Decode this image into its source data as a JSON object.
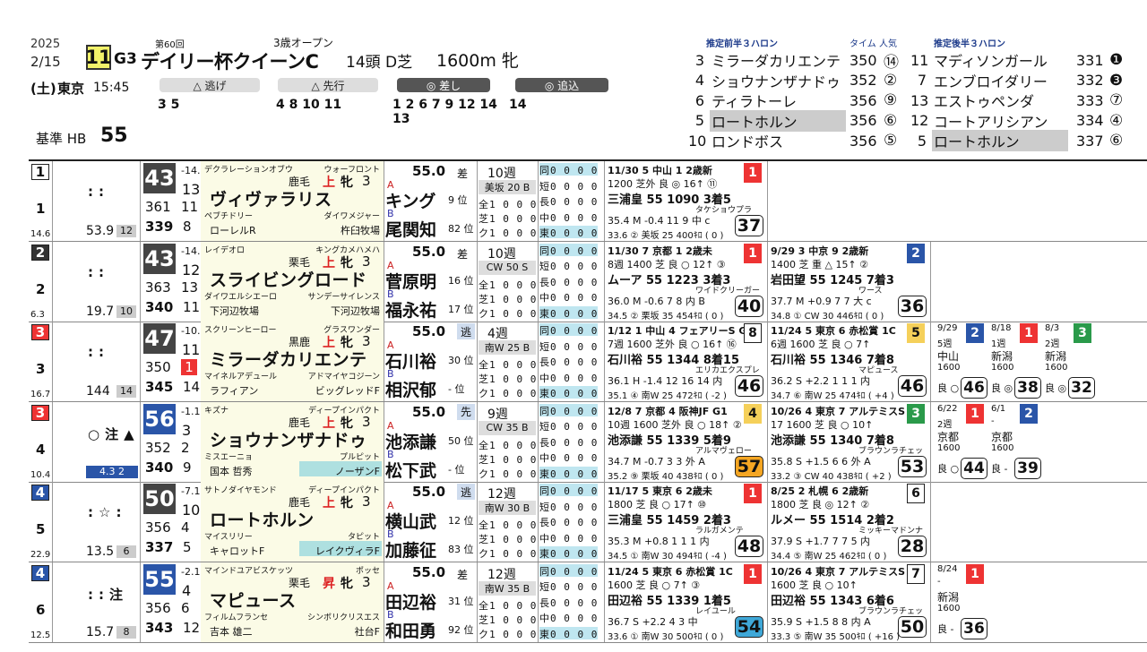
{
  "header": {
    "year": "2025",
    "date": "2/15",
    "race_no": "11",
    "grade": "G3",
    "nth": "第60回",
    "class": "3歳オープン",
    "title": "デイリー杯クイーンC",
    "heads": "14頭",
    "course": "D芝",
    "distance": "1600m 牝",
    "dow": "(土)",
    "venue": "東京",
    "post_time": "15:45",
    "hb_label": "基準 HB",
    "hb_value": "55"
  },
  "styles": [
    {
      "label": "△ 逃げ",
      "horses": "3 5"
    },
    {
      "label": "△ 先行",
      "horses": "4 8 10 11"
    },
    {
      "label": "◎ 差し",
      "horses": "1 2 6 7 9 12 14",
      "horses2": "13"
    },
    {
      "label": "◎ 追込",
      "horses": "14"
    }
  ],
  "pace": {
    "front_title": "推定前半３ハロン",
    "front_sub": "タイム 人気",
    "back_title": "推定後半３ハロン",
    "front": [
      {
        "no": "3",
        "name": "ミラーダカリエンテ",
        "time": "350",
        "rank": "⑭"
      },
      {
        "no": "4",
        "name": "ショウナンザナドゥ",
        "time": "352",
        "rank": "②"
      },
      {
        "no": "6",
        "name": "ティラトーレ",
        "time": "356",
        "rank": "⑨"
      },
      {
        "no": "5",
        "name": "ロートホルン",
        "time": "356",
        "rank": "⑥"
      },
      {
        "no": "10",
        "name": "ロンドボス",
        "time": "356",
        "rank": "⑤"
      }
    ],
    "back": [
      {
        "no": "11",
        "name": "マディソンガール",
        "time": "331",
        "rank": "❶"
      },
      {
        "no": "7",
        "name": "エンブロイダリー",
        "time": "332",
        "rank": "❸"
      },
      {
        "no": "13",
        "name": "エストゥペンダ",
        "time": "333",
        "rank": "⑦"
      },
      {
        "no": "12",
        "name": "コートアリシアン",
        "time": "334",
        "rank": "④"
      },
      {
        "no": "5",
        "name": "ロートホルン",
        "time": "337",
        "rank": "⑥"
      }
    ]
  },
  "rows": [
    {
      "frame": "1",
      "no": "1",
      "foot": "14.6",
      "mark": "::",
      "odds": "53.9",
      "odds_rank": "12",
      "idx": "43",
      "idx_d": "-14.1",
      "idx_r": "13",
      "s1": "361",
      "r1": "11",
      "s2": "339",
      "r2": "8",
      "sire": "デクラレーションオブウ",
      "sire2": "ウォーフロント",
      "coat": "鹿毛",
      "sex": "上",
      "sexj": "牝",
      "age": "3",
      "name": "ヴィヴァラリス",
      "dam": "ペブチドリー",
      "dam2": "ダイワメジャー",
      "breeder": "ローレルR",
      "breeder2": "杵臼牧場",
      "weight": "55.0",
      "style": "差",
      "j1": "キング",
      "j1r": "9 位",
      "j2": "尾関知",
      "j2r": "82 位",
      "tr1": "10週",
      "trbox": "美坂 20 B",
      "past1": {
        "date": "11/30",
        "venue": "5 中山 1 2歳新",
        "line2": "1200 芝外 良 ◎ 16↑ ⑪",
        "line3": "三浦皇 55 1090 3着5",
        "line4": "タケショウプラ",
        "line5": "35.4 M -0.4 11 9 中 c",
        "line6": "33.6 ② 美坂 25 400ｷﾛ ( 0 )",
        "res": "1",
        "score": "37"
      }
    },
    {
      "frame": "2",
      "no": "2",
      "foot": "6.3",
      "mark": "::",
      "odds": "19.7",
      "odds_rank": "10",
      "idx": "43",
      "idx_d": "-14.0",
      "idx_r": "12",
      "s1": "363",
      "r1": "13",
      "s2": "340",
      "r2": "11",
      "sire": "レイデオロ",
      "sire2": "キングカメハメハ",
      "coat": "栗毛",
      "sex": "上",
      "sexj": "牝",
      "age": "3",
      "name": "スライビングロード",
      "dam": "ダイワエルシエーロ",
      "dam2": "サンデーサイレンス",
      "breeder": "下河辺牧場",
      "breeder2": "下河辺牧場",
      "weight": "55.0",
      "style": "差",
      "j1": "菅原明",
      "j1r": "16 位",
      "j2": "福永祐",
      "j2r": "17 位",
      "tr1": "10週",
      "trbox": "CW 50 S",
      "past1": {
        "date": "11/30",
        "venue": "7 京都 1 2歳未",
        "line2": "8週 1400 芝 良 ○ 12↑ ③",
        "line3": "ムーア 55 1223 3着3",
        "line4": "ワイドクリーガー",
        "line5": "36.0 M -0.6 7 8 内 B",
        "line6": "34.5 ② 栗坂 35 454ｷﾛ ( 0 )",
        "res": "1",
        "score": "40"
      },
      "past2": {
        "date": "9/29",
        "venue": "3 中京 9 2歳新",
        "line2": "1400 芝 重 △ 15↑ ②",
        "line3": "岩田望 55 1245 7着3",
        "line4": "ワース",
        "line5": "37.7 M +0.9 7 7 大 c",
        "line6": "34.8 ① CW 30 446ｷﾛ ( 0 )",
        "res": "2",
        "score": "36"
      }
    },
    {
      "frame": "3",
      "no": "3",
      "foot": "16.7",
      "mark": "::",
      "odds": "144",
      "odds_rank": "14",
      "idx": "47",
      "idx_d": "-10.1",
      "idx_r": "11",
      "s1": "350",
      "r1": "1",
      "s2": "345",
      "r2": "14",
      "sire": "スクリーンヒーロー",
      "sire2": "グラスワンダー",
      "coat": "黒鹿",
      "sex": "上",
      "sexj": "牝",
      "age": "3",
      "name": "ミラーダカリエンテ",
      "dam": "マイネルアデュール",
      "dam2": "アドマイヤコジーン",
      "breeder": "ラフィアン",
      "breeder2": "ビッグレッドF",
      "weight": "55.0",
      "style": "逃",
      "j1": "石川裕",
      "j1r": "30 位",
      "j2": "相沢郁",
      "j2r": "- 位",
      "tr1": "4週",
      "trbox": "南W 25 B",
      "past1": {
        "date": "1/12",
        "venue": "1 中山 4 フェアリーS G3",
        "line2": "7週 1600 芝外 良 ○ 16↑ ⑯",
        "line3": "石川裕 55 1344 8着15",
        "line4": "エリカエクスプレ",
        "line5": "36.1 H -1.4 12 16 14 内",
        "line6": "35.1 ④ 南W 25 472ｷﾛ ( -2 )",
        "res": "8",
        "score": "46"
      },
      "past2": {
        "date": "11/24",
        "venue": "5 東京 6 赤松賞 1C",
        "line2": "6週 1600 芝 良 ○ 7↑",
        "line3": "石川裕 55 1346 7着8",
        "line4": "マピュース",
        "line5": "36.2 S +2.2 1 1 1 内",
        "line6": "34.7 ⑥ 南W 25 474ｷﾛ ( +4 )",
        "res": "5",
        "score": "46"
      },
      "mini": [
        {
          "date": "9/29",
          "w": "5週",
          "v": "中山",
          "d": "1600",
          "g": "良 ○",
          "res": "2",
          "score": "46"
        },
        {
          "date": "8/18",
          "w": "1週",
          "v": "新潟",
          "d": "1600",
          "g": "良 ◎",
          "res": "1",
          "score": "38"
        },
        {
          "date": "8/3",
          "w": "2週",
          "v": "新潟",
          "d": "1600",
          "g": "良 ◎",
          "res": "3",
          "score": "32"
        }
      ]
    },
    {
      "frame": "3",
      "no": "4",
      "foot": "10.4",
      "mark": "○注▲",
      "odds": "4.3",
      "odds_rank": "2",
      "idx": "56",
      "idx_d": "-1.1",
      "idx_r": "3",
      "s1": "352",
      "r1": "2",
      "s2": "340",
      "r2": "9",
      "sire": "キズナ",
      "sire2": "ディープインパクト",
      "coat": "鹿毛",
      "sex": "上",
      "sexj": "牝",
      "age": "3",
      "name": "ショウナンザナドゥ",
      "dam": "ミスエーニョ",
      "dam2": "プルピット",
      "breeder": "国本 哲秀",
      "breeder2": "ノーザンF",
      "weight": "55.0",
      "style": "先",
      "j1": "池添謙",
      "j1r": "50 位",
      "j2": "松下武",
      "j2r": "- 位",
      "tr1": "9週",
      "trbox": "CW 35 B",
      "past1": {
        "date": "12/8",
        "venue": "7 京都 4 阪神JF G1",
        "line2": "10週 1600 芝外 良 ○ 18↑ ②",
        "line3": "池添謙 55 1339 5着9",
        "line4": "アルマヴェロー",
        "line5": "34.7 M -0.7 3 3 外 A",
        "line6": "35.2 ⑨ 栗坂 40 438ｷﾛ ( 0 )",
        "res": "4",
        "score": "57"
      },
      "past2": {
        "date": "10/26",
        "venue": "4 東京 7 アルテミスS G3",
        "line2": "17 1600 芝 良 ○ 10↑",
        "line3": "池添謙 55 1340 7着8",
        "line4": "ブラウンラチェッ",
        "line5": "35.8 S +1.5 6 6 外 A",
        "line6": "33.2 ③ CW 40 438ｷﾛ ( +2 )",
        "res": "3",
        "score": "53"
      },
      "mini": [
        {
          "date": "6/22",
          "w": "2週",
          "v": "京都",
          "d": "1600",
          "g": "良 ○",
          "res": "1",
          "score": "44"
        },
        {
          "date": "6/1",
          "w": "-",
          "v": "京都",
          "d": "1600",
          "g": "良 -",
          "res": "2",
          "score": "39"
        }
      ]
    },
    {
      "frame": "4",
      "no": "5",
      "foot": "22.9",
      "mark": ":☆:",
      "odds": "13.5",
      "odds_rank": "6",
      "idx": "50",
      "idx_d": "-7.1",
      "idx_r": "10",
      "s1": "356",
      "r1": "4",
      "s2": "337",
      "r2": "5",
      "sire": "サトノダイヤモンド",
      "sire2": "ディープインパクト",
      "coat": "鹿毛",
      "sex": "上",
      "sexj": "牝",
      "age": "3",
      "name": "ロートホルン",
      "dam": "マイスリリー",
      "dam2": "タピット",
      "breeder": "キャロットF",
      "breeder2": "レイクヴィラF",
      "weight": "55.0",
      "style": "逃",
      "j1": "横山武",
      "j1r": "12 位",
      "j2": "加藤征",
      "j2r": "83 位",
      "tr1": "12週",
      "trbox": "南W 30 B",
      "past1": {
        "date": "11/17",
        "venue": "5 東京 6 2歳未",
        "line2": "1800 芝 良 ○ 17↑ ⑩",
        "line3": "三浦皇 55 1459 2着3",
        "line4": "ラルガメンテ",
        "line5": "35.3 M +0.8 1 1 1 内",
        "line6": "34.5 ① 南W 30 494ｷﾛ ( -4 )",
        "res": "1",
        "score": "48"
      },
      "past2": {
        "date": "8/25",
        "venue": "2 札幌 6 2歳新",
        "line2": "1800 芝 良 ◎ 12↑ ②",
        "line3": "ルメー 55 1514 2着2",
        "line4": "ミッキーマドンナ",
        "line5": "37.9 S +1.7 7 7 5 内",
        "line6": "34.4 ⑤ 南W 25 462ｷﾛ ( 0 )",
        "res": "6",
        "score": "28"
      }
    },
    {
      "frame": "4",
      "no": "6",
      "foot": "12.5",
      "mark": "::注",
      "odds": "15.7",
      "odds_rank": "8",
      "idx": "55",
      "idx_d": "-2.1",
      "idx_r": "4",
      "s1": "356",
      "r1": "6",
      "s2": "343",
      "r2": "12",
      "sire": "マインドユアビスケッツ",
      "sire2": "ポッセ",
      "coat": "栗毛",
      "sex": "昇",
      "sexj": "牝",
      "age": "3",
      "name": "マピュース",
      "dam": "フィルムフランセ",
      "dam2": "シンボリクリスエス",
      "breeder": "吉本 雄二",
      "breeder2": "社台F",
      "weight": "55.0",
      "style": "差",
      "j1": "田辺裕",
      "j1r": "31 位",
      "j2": "和田勇",
      "j2r": "92 位",
      "tr1": "12週",
      "trbox": "南W 35 B",
      "past1": {
        "date": "11/24",
        "venue": "5 東京 6 赤松賞 1C",
        "line2": "1600 芝 良 ○ 7↑ ③",
        "line3": "田辺裕 55 1339 1着5",
        "line4": "レイユール",
        "line5": "36.7 S +2.2 4 3 中",
        "line6": "33.6 ① 南W 30 500ｷﾛ ( 0 )",
        "res": "1",
        "score": "54"
      },
      "past2": {
        "date": "10/26",
        "venue": "4 東京 7 アルテミスS G3",
        "line2": "1600 芝 良 ○ 10↑",
        "line3": "田辺裕 55 1343 6着6",
        "line4": "ブラウンラチェッ",
        "line5": "35.9 S +1.5 8 8 内 A",
        "line6": "33.3 ⑤ 南W 35 500ｷﾛ ( +16 )",
        "res": "7",
        "score": "50"
      },
      "mini": [
        {
          "date": "8/24",
          "w": "-",
          "v": "新潟",
          "d": "1600",
          "g": "良 -",
          "res": "1",
          "score": "36"
        }
      ]
    }
  ]
}
